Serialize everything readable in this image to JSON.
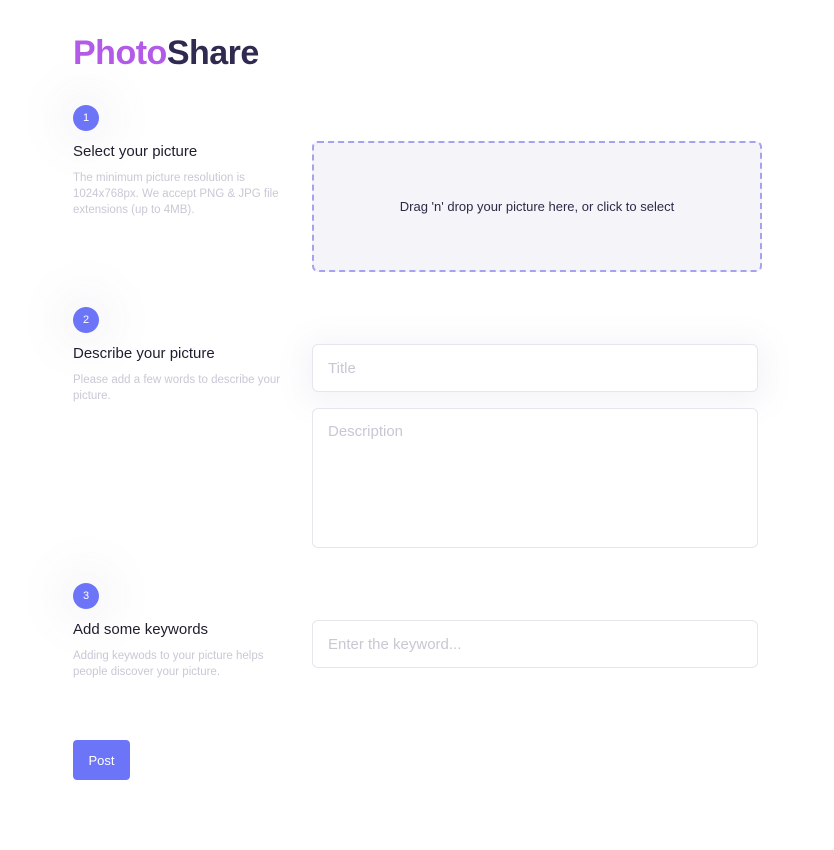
{
  "brand": {
    "part1": "Photo",
    "part2": "Share",
    "color_part1": "#b45ae8",
    "color_part2": "#2f2a4f"
  },
  "accent_color": "#6c74f7",
  "steps": [
    {
      "number": "1",
      "title": "Select your picture",
      "description": "The minimum picture resolution is 1024x768px. We accept PNG & JPG file extensions (up to 4MB)."
    },
    {
      "number": "2",
      "title": "Describe your picture",
      "description": "Please add a few words to describe your picture."
    },
    {
      "number": "3",
      "title": "Add some keywords",
      "description": "Adding keywods to your picture helps people discover your picture."
    }
  ],
  "dropzone": {
    "text": "Drag 'n' drop your picture here, or click to select"
  },
  "fields": {
    "title": {
      "value": "",
      "placeholder": "Title"
    },
    "description": {
      "value": "",
      "placeholder": "Description"
    },
    "keyword": {
      "value": "",
      "placeholder": "Enter the keyword..."
    }
  },
  "post_button": {
    "label": "Post"
  }
}
